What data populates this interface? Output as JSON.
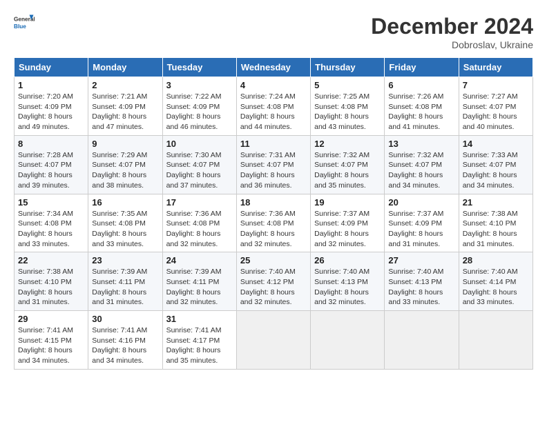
{
  "logo": {
    "line1": "General",
    "line2": "Blue"
  },
  "title": "December 2024",
  "subtitle": "Dobroslav, Ukraine",
  "weekdays": [
    "Sunday",
    "Monday",
    "Tuesday",
    "Wednesday",
    "Thursday",
    "Friday",
    "Saturday"
  ],
  "weeks": [
    [
      {
        "day": "1",
        "sunrise": "Sunrise: 7:20 AM",
        "sunset": "Sunset: 4:09 PM",
        "daylight": "Daylight: 8 hours and 49 minutes."
      },
      {
        "day": "2",
        "sunrise": "Sunrise: 7:21 AM",
        "sunset": "Sunset: 4:09 PM",
        "daylight": "Daylight: 8 hours and 47 minutes."
      },
      {
        "day": "3",
        "sunrise": "Sunrise: 7:22 AM",
        "sunset": "Sunset: 4:09 PM",
        "daylight": "Daylight: 8 hours and 46 minutes."
      },
      {
        "day": "4",
        "sunrise": "Sunrise: 7:24 AM",
        "sunset": "Sunset: 4:08 PM",
        "daylight": "Daylight: 8 hours and 44 minutes."
      },
      {
        "day": "5",
        "sunrise": "Sunrise: 7:25 AM",
        "sunset": "Sunset: 4:08 PM",
        "daylight": "Daylight: 8 hours and 43 minutes."
      },
      {
        "day": "6",
        "sunrise": "Sunrise: 7:26 AM",
        "sunset": "Sunset: 4:08 PM",
        "daylight": "Daylight: 8 hours and 41 minutes."
      },
      {
        "day": "7",
        "sunrise": "Sunrise: 7:27 AM",
        "sunset": "Sunset: 4:07 PM",
        "daylight": "Daylight: 8 hours and 40 minutes."
      }
    ],
    [
      {
        "day": "8",
        "sunrise": "Sunrise: 7:28 AM",
        "sunset": "Sunset: 4:07 PM",
        "daylight": "Daylight: 8 hours and 39 minutes."
      },
      {
        "day": "9",
        "sunrise": "Sunrise: 7:29 AM",
        "sunset": "Sunset: 4:07 PM",
        "daylight": "Daylight: 8 hours and 38 minutes."
      },
      {
        "day": "10",
        "sunrise": "Sunrise: 7:30 AM",
        "sunset": "Sunset: 4:07 PM",
        "daylight": "Daylight: 8 hours and 37 minutes."
      },
      {
        "day": "11",
        "sunrise": "Sunrise: 7:31 AM",
        "sunset": "Sunset: 4:07 PM",
        "daylight": "Daylight: 8 hours and 36 minutes."
      },
      {
        "day": "12",
        "sunrise": "Sunrise: 7:32 AM",
        "sunset": "Sunset: 4:07 PM",
        "daylight": "Daylight: 8 hours and 35 minutes."
      },
      {
        "day": "13",
        "sunrise": "Sunrise: 7:32 AM",
        "sunset": "Sunset: 4:07 PM",
        "daylight": "Daylight: 8 hours and 34 minutes."
      },
      {
        "day": "14",
        "sunrise": "Sunrise: 7:33 AM",
        "sunset": "Sunset: 4:07 PM",
        "daylight": "Daylight: 8 hours and 34 minutes."
      }
    ],
    [
      {
        "day": "15",
        "sunrise": "Sunrise: 7:34 AM",
        "sunset": "Sunset: 4:08 PM",
        "daylight": "Daylight: 8 hours and 33 minutes."
      },
      {
        "day": "16",
        "sunrise": "Sunrise: 7:35 AM",
        "sunset": "Sunset: 4:08 PM",
        "daylight": "Daylight: 8 hours and 33 minutes."
      },
      {
        "day": "17",
        "sunrise": "Sunrise: 7:36 AM",
        "sunset": "Sunset: 4:08 PM",
        "daylight": "Daylight: 8 hours and 32 minutes."
      },
      {
        "day": "18",
        "sunrise": "Sunrise: 7:36 AM",
        "sunset": "Sunset: 4:08 PM",
        "daylight": "Daylight: 8 hours and 32 minutes."
      },
      {
        "day": "19",
        "sunrise": "Sunrise: 7:37 AM",
        "sunset": "Sunset: 4:09 PM",
        "daylight": "Daylight: 8 hours and 32 minutes."
      },
      {
        "day": "20",
        "sunrise": "Sunrise: 7:37 AM",
        "sunset": "Sunset: 4:09 PM",
        "daylight": "Daylight: 8 hours and 31 minutes."
      },
      {
        "day": "21",
        "sunrise": "Sunrise: 7:38 AM",
        "sunset": "Sunset: 4:10 PM",
        "daylight": "Daylight: 8 hours and 31 minutes."
      }
    ],
    [
      {
        "day": "22",
        "sunrise": "Sunrise: 7:38 AM",
        "sunset": "Sunset: 4:10 PM",
        "daylight": "Daylight: 8 hours and 31 minutes."
      },
      {
        "day": "23",
        "sunrise": "Sunrise: 7:39 AM",
        "sunset": "Sunset: 4:11 PM",
        "daylight": "Daylight: 8 hours and 31 minutes."
      },
      {
        "day": "24",
        "sunrise": "Sunrise: 7:39 AM",
        "sunset": "Sunset: 4:11 PM",
        "daylight": "Daylight: 8 hours and 32 minutes."
      },
      {
        "day": "25",
        "sunrise": "Sunrise: 7:40 AM",
        "sunset": "Sunset: 4:12 PM",
        "daylight": "Daylight: 8 hours and 32 minutes."
      },
      {
        "day": "26",
        "sunrise": "Sunrise: 7:40 AM",
        "sunset": "Sunset: 4:13 PM",
        "daylight": "Daylight: 8 hours and 32 minutes."
      },
      {
        "day": "27",
        "sunrise": "Sunrise: 7:40 AM",
        "sunset": "Sunset: 4:13 PM",
        "daylight": "Daylight: 8 hours and 33 minutes."
      },
      {
        "day": "28",
        "sunrise": "Sunrise: 7:40 AM",
        "sunset": "Sunset: 4:14 PM",
        "daylight": "Daylight: 8 hours and 33 minutes."
      }
    ],
    [
      {
        "day": "29",
        "sunrise": "Sunrise: 7:41 AM",
        "sunset": "Sunset: 4:15 PM",
        "daylight": "Daylight: 8 hours and 34 minutes."
      },
      {
        "day": "30",
        "sunrise": "Sunrise: 7:41 AM",
        "sunset": "Sunset: 4:16 PM",
        "daylight": "Daylight: 8 hours and 34 minutes."
      },
      {
        "day": "31",
        "sunrise": "Sunrise: 7:41 AM",
        "sunset": "Sunset: 4:17 PM",
        "daylight": "Daylight: 8 hours and 35 minutes."
      },
      null,
      null,
      null,
      null
    ]
  ]
}
